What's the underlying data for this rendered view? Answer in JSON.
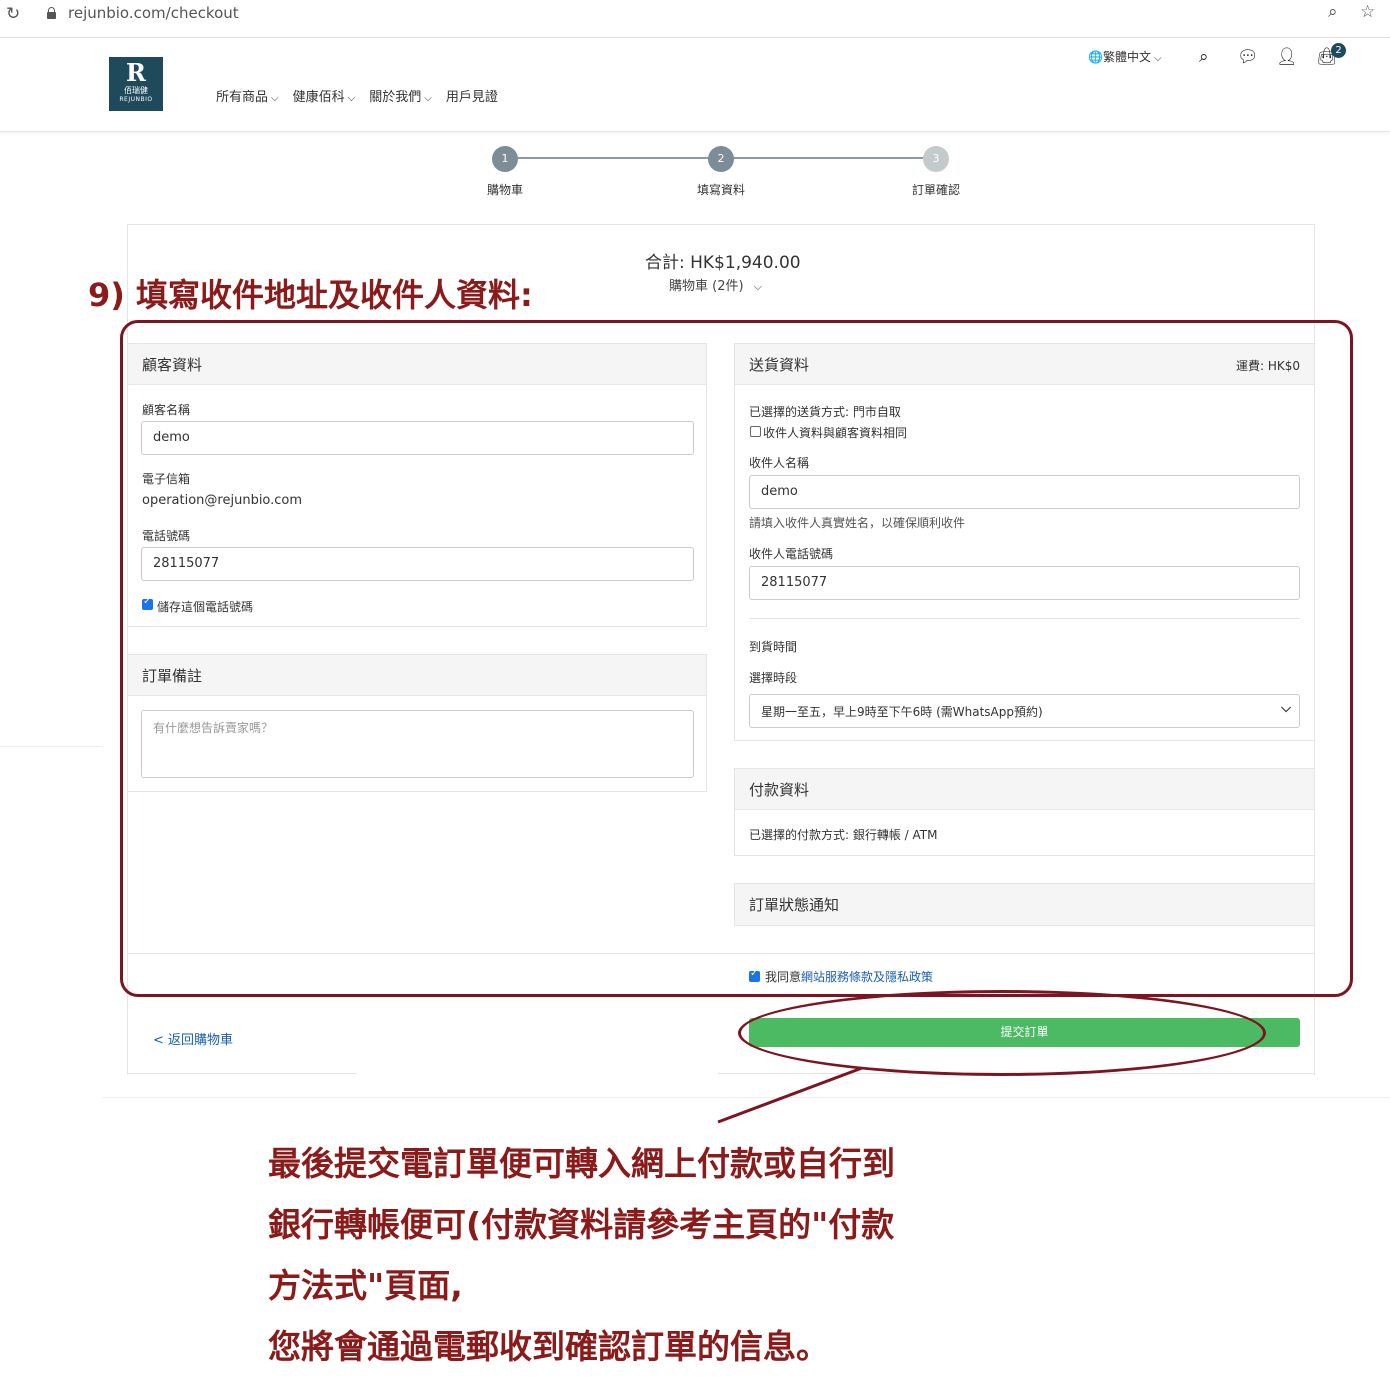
{
  "browser": {
    "url": "rejunbio.com/checkout"
  },
  "header": {
    "logo": {
      "mark": "R",
      "cn": "佰瑞健",
      "en": "REJUNBIO"
    },
    "nav": [
      "所有商品",
      "健康佰科",
      "關於我們",
      "用戶見證"
    ],
    "language": "繁體中文",
    "cart_count": "2"
  },
  "steps": [
    {
      "number": "1",
      "label": "購物車"
    },
    {
      "number": "2",
      "label": "填寫資料"
    },
    {
      "number": "3",
      "label": "訂單確認"
    }
  ],
  "summary": {
    "total": "合計: HK$1,940.00",
    "cart": "購物車 (2件)"
  },
  "customer": {
    "title": "顧客資料",
    "name_label": "顧客名稱",
    "name_value": "demo",
    "email_label": "電子信箱",
    "email_value": "operation@rejunbio.com",
    "phone_label": "電話號碼",
    "phone_value": "28115077",
    "save_phone_label": "儲存這個電話號碼"
  },
  "notes": {
    "title": "訂單備註",
    "placeholder": "有什麼想告訴賣家嗎？"
  },
  "delivery": {
    "title": "送貨資料",
    "fee": "運費: HK$0",
    "method": "已選擇的送貨方式: 門市自取",
    "same_as_customer": "收件人資料與顧客資料相同",
    "recipient_name_label": "收件人名稱",
    "recipient_name_value": "demo",
    "recipient_name_hint": "請填入收件人真實姓名，以確保順利收件",
    "recipient_phone_label": "收件人電話號碼",
    "recipient_phone_value": "28115077",
    "arrival_time_label": "到貨時間",
    "timeslot_label": "選擇時段",
    "timeslot_value": "星期一至五，早上9時至下午6時 (需WhatsApp預約)"
  },
  "payment": {
    "title": "付款資料",
    "method": "已選擇的付款方式: 銀行轉帳 / ATM"
  },
  "notification": {
    "title": "訂單狀態通知"
  },
  "agree": {
    "prefix": "我同意",
    "link": "網站服務條款及隱私政策"
  },
  "actions": {
    "back": "< 返回購物車",
    "submit": "提交訂單"
  },
  "annotations": {
    "title": "9) 填寫收件地址及收件人資料:",
    "lines": [
      "最後提交電訂單便可轉入網上付款或自行到",
      "銀行轉帳便可(付款資料請參考主頁的\"付款",
      "方法式\"頁面,",
      "您將會通過電郵收到確認訂單的信息。"
    ]
  },
  "colors": {
    "brand": "#1e4a5c",
    "submit": "#4cb963",
    "annotation": "#8b1a1a",
    "link": "#1a5fb4"
  }
}
